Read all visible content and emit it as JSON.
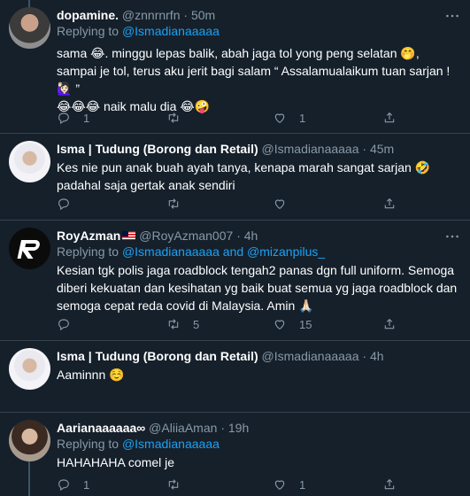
{
  "tweets": [
    {
      "display_name": "dopamine.",
      "handle": "@znnrnrfn",
      "sep": "·",
      "time": "50m",
      "replying_prefix": "Replying to",
      "replying_to": "@Ismadianaaaaa",
      "text_lines": [
        "sama 😂. minggu lepas balik, abah jaga tol yong peng selatan 🤭,",
        "sampai je tol, terus aku jerit bagi salam “ Assalamualaikum tuan sarjan !",
        "🙋🏻‍♀️ ”",
        "😂😂😂 naik malu dia 😂🤪"
      ],
      "reply_count": "1",
      "retweet_count": "",
      "like_count": "1"
    },
    {
      "display_name": "Isma | Tudung (Borong dan Retail)",
      "handle": "@Ismadianaaaaa",
      "sep": "·",
      "time": "45m",
      "text_lines": [
        "Kes nie pun anak buah ayah tanya, kenapa marah sangat sarjan 🤣",
        "padahal saja gertak anak sendiri"
      ],
      "reply_count": "",
      "retweet_count": "",
      "like_count": ""
    },
    {
      "display_name": "RoyAzman",
      "handle": "@RoyAzman007",
      "sep": "·",
      "time": "4h",
      "replying_prefix": "Replying to",
      "replying_to": "@Ismadianaaaaa and @mizanpilus_",
      "text_lines": [
        "Kesian tgk polis jaga roadblock tengah2 panas dgn full uniform. Semoga",
        "diberi kekuatan dan kesihatan yg baik buat semua yg jaga roadblock dan",
        "semoga cepat reda covid di Malaysia. Amin 🙏🏻"
      ],
      "reply_count": "",
      "retweet_count": "5",
      "like_count": "15"
    },
    {
      "display_name": "Isma | Tudung (Borong dan Retail)",
      "handle": "@Ismadianaaaaa",
      "sep": "·",
      "time": "4h",
      "text_lines": [
        "Aaminnn ☺️"
      ],
      "reply_count": "",
      "retweet_count": "",
      "like_count": ""
    },
    {
      "display_name": "Aarianaaaaaa∞",
      "handle": "@AliiaAman",
      "sep": "·",
      "time": "19h",
      "replying_prefix": "Replying to",
      "replying_to": "@Ismadianaaaaa",
      "text_lines": [
        "HAHAHAHA comel je"
      ],
      "reply_count": "1",
      "retweet_count": "",
      "like_count": "1"
    }
  ],
  "colors": {
    "background": "#15202b",
    "muted": "#8899a6",
    "link": "#1da1f2",
    "divider": "#38444d"
  },
  "icons": [
    "reply-icon",
    "retweet-icon",
    "like-icon",
    "share-icon",
    "more-icon"
  ]
}
